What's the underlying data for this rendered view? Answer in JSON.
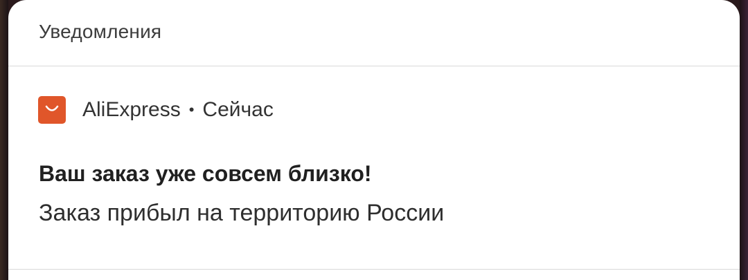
{
  "panel": {
    "title": "Уведомления"
  },
  "notification": {
    "app_name": "AliExpress",
    "separator": "•",
    "time": "Сейчас",
    "title": "Ваш заказ уже совсем близко!",
    "body": "Заказ прибыл на территорию России",
    "icon": "aliexpress-bag-icon",
    "icon_color": "#e0562a"
  }
}
